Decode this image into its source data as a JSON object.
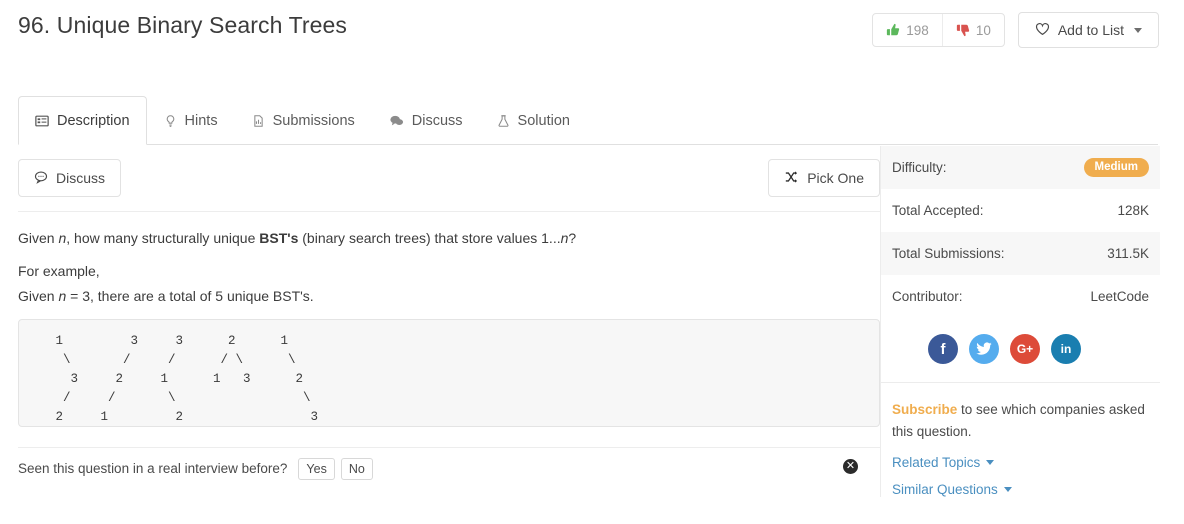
{
  "header": {
    "title": "96. Unique Binary Search Trees",
    "upvotes": "198",
    "downvotes": "10",
    "add_to_list_label": "Add to List"
  },
  "tabs": [
    {
      "label": "Description",
      "icon": "list-icon",
      "active": true
    },
    {
      "label": "Hints",
      "icon": "lightbulb-icon",
      "active": false
    },
    {
      "label": "Submissions",
      "icon": "file-icon",
      "active": false
    },
    {
      "label": "Discuss",
      "icon": "chat-icon",
      "active": false
    },
    {
      "label": "Solution",
      "icon": "flask-icon",
      "active": false
    }
  ],
  "toolbar": {
    "discuss_label": "Discuss",
    "pick_one_label": "Pick One"
  },
  "description": {
    "line1_a": "Given ",
    "line1_n1": "n",
    "line1_b": ", how many structurally unique ",
    "line1_bold": "BST's",
    "line1_c": " (binary search trees) that store values 1...",
    "line1_n2": "n",
    "line1_d": "?",
    "for_example": "For example,",
    "given_a": "Given ",
    "given_n": "n",
    "given_b": " = 3, there are a total of 5 unique BST's.",
    "code_block": "   1         3     3      2      1\n    \\       /     /      / \\      \\\n     3     2     1      1   3      2\n    /     /       \\                 \\\n   2     1         2                 3"
  },
  "survey": {
    "question": "Seen this question in a real interview before?",
    "yes_label": "Yes",
    "no_label": "No",
    "dismiss_icon": "close-circle-icon"
  },
  "sidebar": {
    "stats": [
      {
        "label": "Difficulty:",
        "value": "Medium",
        "is_pill": true
      },
      {
        "label": "Total Accepted:",
        "value": "128K",
        "is_pill": false
      },
      {
        "label": "Total Submissions:",
        "value": "311.5K",
        "is_pill": false
      },
      {
        "label": "Contributor:",
        "value": "LeetCode",
        "is_pill": false
      }
    ],
    "social": [
      {
        "name": "facebook-icon",
        "glyph": "f",
        "color": "#3b5998"
      },
      {
        "name": "twitter-icon",
        "glyph": "t",
        "color": "#55acee"
      },
      {
        "name": "google-plus-icon",
        "glyph": "G+",
        "color": "#dd4b39"
      },
      {
        "name": "linkedin-icon",
        "glyph": "in",
        "color": "#1a7eb0"
      }
    ],
    "subscribe_link": "Subscribe",
    "subscribe_rest": " to see which companies asked this question.",
    "related_topics": "Related Topics",
    "similar_questions": "Similar Questions"
  },
  "colors": {
    "difficulty_medium": "#f0ad4e",
    "upvote_green": "#5cb85c",
    "downvote_red": "#d9534f",
    "link_blue": "#4a8fc0"
  }
}
